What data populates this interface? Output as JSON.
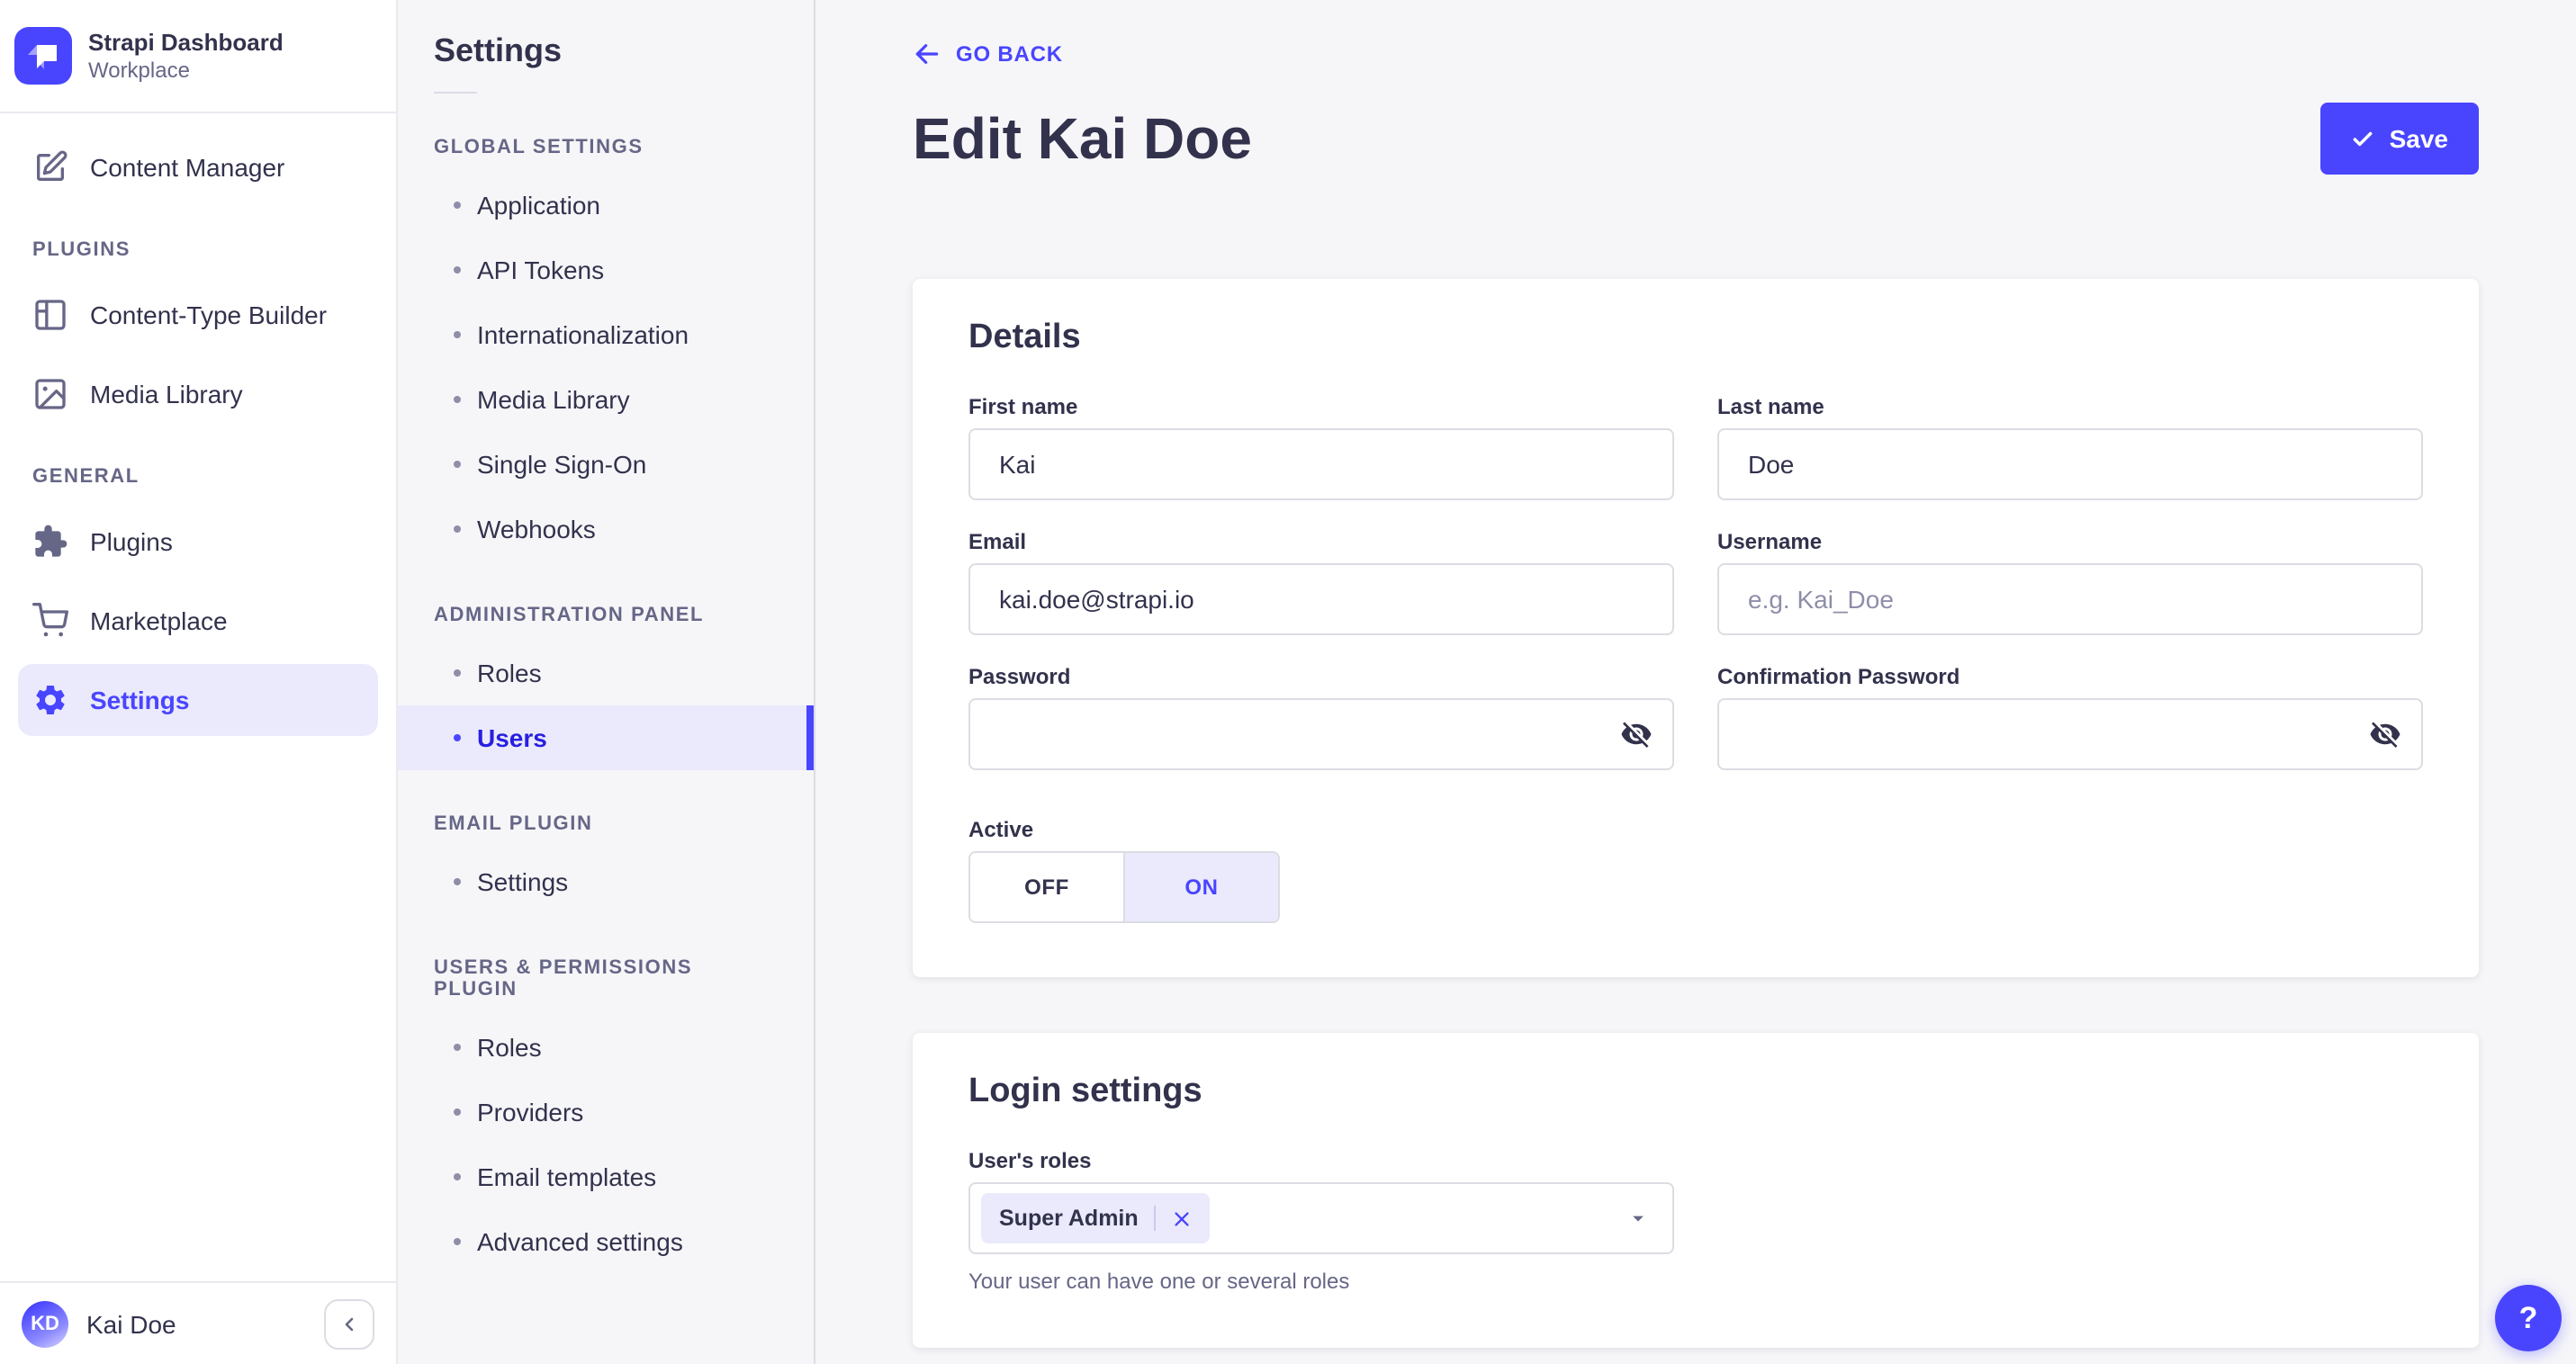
{
  "colors": {
    "primary": "#4945ff",
    "primary_dark": "#271fe0",
    "primary_light_bg": "#eaeafc",
    "text_dark": "#32324d",
    "text_gray": "#666687",
    "placeholder": "#8e8ea9",
    "border": "#dcdce4",
    "page_bg": "#f6f6f9"
  },
  "main_nav": {
    "brand": {
      "title": "Strapi Dashboard",
      "subtitle": "Workplace",
      "logo_icon": "strapi-logo"
    },
    "content_manager": {
      "label": "Content Manager",
      "icon": "feather-pen-icon"
    },
    "sections": [
      {
        "title": "PLUGINS",
        "items": [
          {
            "label": "Content-Type Builder",
            "icon": "layout-icon"
          },
          {
            "label": "Media Library",
            "icon": "image-icon"
          }
        ]
      },
      {
        "title": "GENERAL",
        "items": [
          {
            "label": "Plugins",
            "icon": "puzzle-icon"
          },
          {
            "label": "Marketplace",
            "icon": "cart-icon"
          },
          {
            "label": "Settings",
            "icon": "gear-icon",
            "selected": true
          }
        ]
      }
    ],
    "footer": {
      "user_initials": "KD",
      "user_name": "Kai Doe",
      "collapse_icon": "chevron-left-icon"
    }
  },
  "settings_nav": {
    "title": "Settings",
    "sections": [
      {
        "title": "GLOBAL SETTINGS",
        "items": [
          "Application",
          "API Tokens",
          "Internationalization",
          "Media Library",
          "Single Sign-On",
          "Webhooks"
        ]
      },
      {
        "title": "ADMINISTRATION PANEL",
        "items": [
          "Roles",
          "Users"
        ],
        "selected_item": "Users"
      },
      {
        "title": "EMAIL PLUGIN",
        "items": [
          "Settings"
        ]
      },
      {
        "title": "USERS & PERMISSIONS PLUGIN",
        "items": [
          "Roles",
          "Providers",
          "Email templates",
          "Advanced settings"
        ]
      }
    ]
  },
  "header": {
    "back_label": "GO BACK",
    "title": "Edit Kai Doe",
    "save_label": "Save"
  },
  "details_card": {
    "title": "Details",
    "first_name": {
      "label": "First name",
      "value": "Kai"
    },
    "last_name": {
      "label": "Last name",
      "value": "Doe"
    },
    "email": {
      "label": "Email",
      "value": "kai.doe@strapi.io"
    },
    "username": {
      "label": "Username",
      "placeholder": "e.g. Kai_Doe"
    },
    "password": {
      "label": "Password"
    },
    "confirm_password": {
      "label": "Confirmation Password"
    },
    "active": {
      "label": "Active",
      "off_label": "OFF",
      "on_label": "ON",
      "value": "ON"
    }
  },
  "login_card": {
    "title": "Login settings",
    "roles_label": "User's roles",
    "selected_role": "Super Admin",
    "hint": "Your user can have one or several roles"
  },
  "help": {
    "label": "?"
  }
}
